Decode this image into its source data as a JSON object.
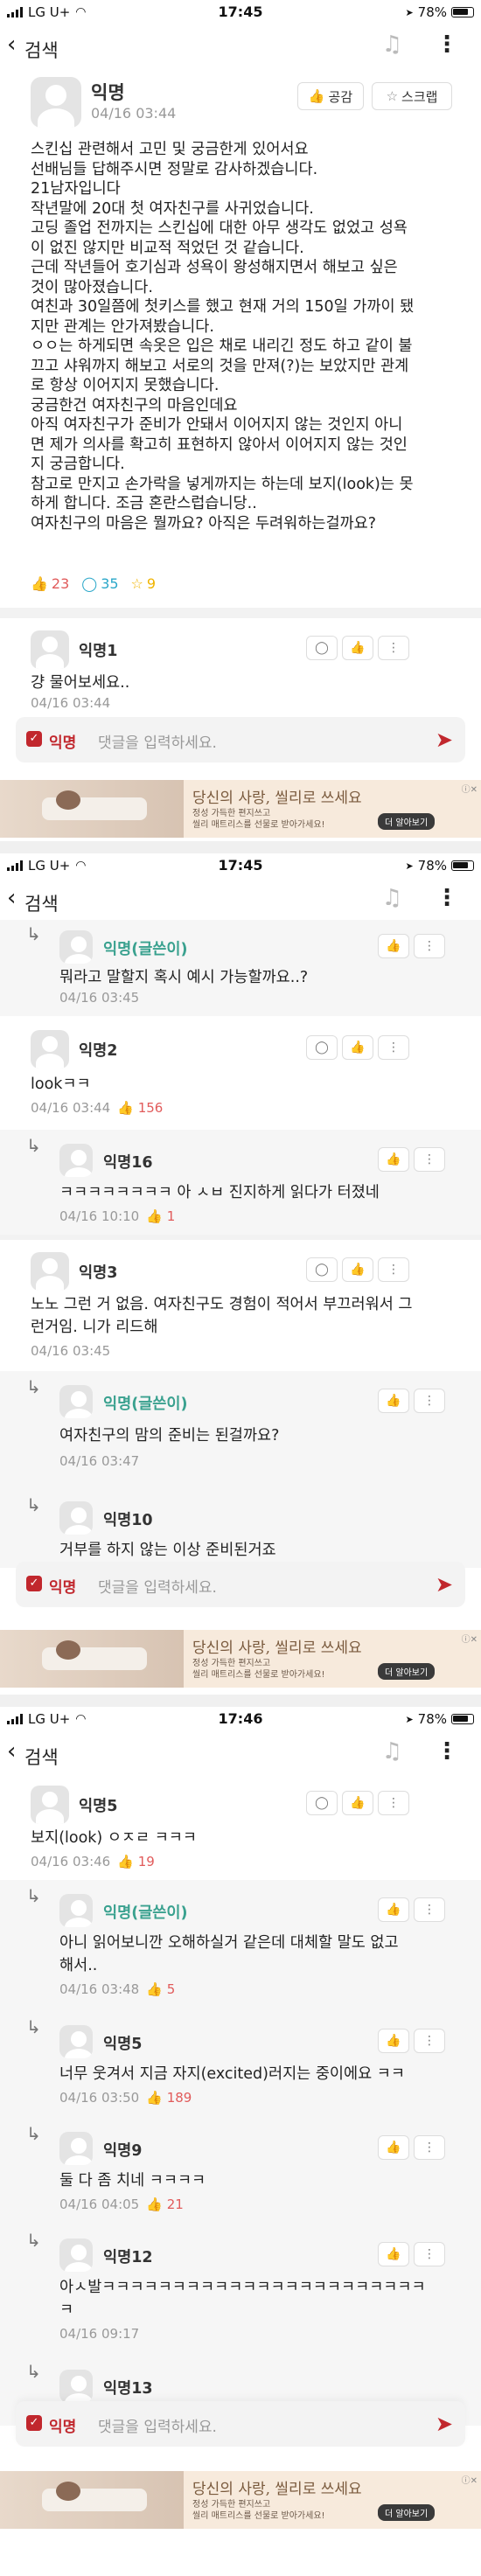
{
  "status": {
    "carrier": "LG U+",
    "battery": "78%",
    "times": [
      "17:45",
      "17:45",
      "17:46"
    ]
  },
  "appbar": {
    "title": "검색"
  },
  "post": {
    "author": "익명",
    "date": "04/16 03:44",
    "like_button": "공감",
    "scrap_button": "스크랩",
    "lines": [
      "스킨십 관련해서 고민 및 궁금한게 있어서요",
      "선배님들 답해주시면 정말로 감사하겠습니다.",
      "21남자입니다",
      "작년말에 20대 첫 여자친구를 사귀었습니다.",
      "고딩 졸업 전까지는 스킨십에 대한 아무 생각도 없었고 성욕",
      "이 없진 않지만 비교적 적었던 것 같습니다.",
      "근데 작년들어 호기심과 성욕이 왕성해지면서 해보고 싶은",
      "것이 많아졌습니다.",
      "여친과 30일쯤에 첫키스를 했고 현재 거의 150일 가까이 됐",
      "지만 관계는 안가져봤습니다.",
      "ㅇㅇ는 하게되면 속옷은 입은 채로 내리긴 정도 하고 같이 불",
      "끄고 샤워까지 해보고 서로의 것을 만져(?)는 보았지만 관계",
      "로 항상 이어지지 못했습니다.",
      " 궁금한건 여자친구의 마음인데요",
      "아직 여자친구가 준비가 안돼서 이어지지 않는 것인지 아니",
      "면 제가 의사를 확고히 표현하지 않아서 이어지지 않는 것인",
      "지 궁금합니다.",
      "참고로 만지고 손가락을 넣게까지는 하는데 보지(look)는 못",
      "하게 합니다. 조금 혼란스럽습니당..",
      "여자친구의 마음은 뭘까요? 아직은 두려워하는걸까요?"
    ],
    "likes": "23",
    "comments": "35",
    "scraps": "9"
  },
  "comments": [
    {
      "author": "익명1",
      "text": "걍 물어보세요..",
      "date": "04/16 03:44"
    },
    {
      "author": "익명(글쓴이)",
      "text": "뭐라고 말할지 혹시 예시 가능할까요..?",
      "date": "04/16 03:45"
    },
    {
      "author": "익명2",
      "text": "lookㅋㅋ",
      "date": "04/16 03:44",
      "likes": "156"
    },
    {
      "author": "익명16",
      "text": "ㅋㅋㅋㅋㅋㅋㅋㅋ 아 ㅅㅂ 진지하게 읽다가 터졌네",
      "date": "04/16 10:10",
      "likes": "1"
    },
    {
      "author": "익명3",
      "text": [
        "노노 그런 거 없음. 여자친구도 경험이 적어서 부끄러워서 그",
        "런거임. 니가 리드해"
      ],
      "date": "04/16 03:45"
    },
    {
      "author": "익명(글쓴이)",
      "text": "여자친구의 맘의 준비는 된걸까요?",
      "date": "04/16 03:47"
    },
    {
      "author": "익명10",
      "text": "거부를 하지 않는 이상 준비된거죠"
    },
    {
      "author": "익명5",
      "text": "보지(look) ㅇㅈㄹ ㅋㅋㅋ",
      "date": "04/16 03:46",
      "likes": "19"
    },
    {
      "author": "익명(글쓴이)",
      "text": [
        "아니 읽어보니깐 오해하실거 같은데 대체할 말도 없고",
        "해서.."
      ],
      "date": "04/16 03:48",
      "likes": "5"
    },
    {
      "author": "익명5",
      "text": "너무 웃겨서 지금 자지(excited)러지는 중이에요 ㅋㅋ",
      "date": "04/16 03:50",
      "likes": "189"
    },
    {
      "author": "익명9",
      "text": "둘 다 좀 치네 ㅋㅋㅋㅋ",
      "date": "04/16 04:05",
      "likes": "21"
    },
    {
      "author": "익명12",
      "text": [
        "아ㅅ발ㅋㅋㅋㅋㅋㅋㅋㅋㅋㅋㅋㅋㅋㅋㅋㅋㅋㅋㅋㅋㅋㅋㅋ",
        "ㅋ"
      ],
      "date": "04/16 09:17"
    },
    {
      "author": "익명13"
    }
  ],
  "input": {
    "anon_label": "익명",
    "placeholder": "댓글을 입력하세요."
  },
  "ad": {
    "title": "당신의 사랑, 씰리로 쓰세요",
    "sub1": "정성 가득한 편지쓰고",
    "sub2": "씰리 매트리스를 선물로 받아가세요!",
    "button": "더 알아보기"
  },
  "colors": {
    "accent": "#c1272d",
    "op_name": "#3aa18f",
    "like": "#e15b5b",
    "comment_count": "#2aa7c9",
    "scrap": "#f0b400"
  }
}
